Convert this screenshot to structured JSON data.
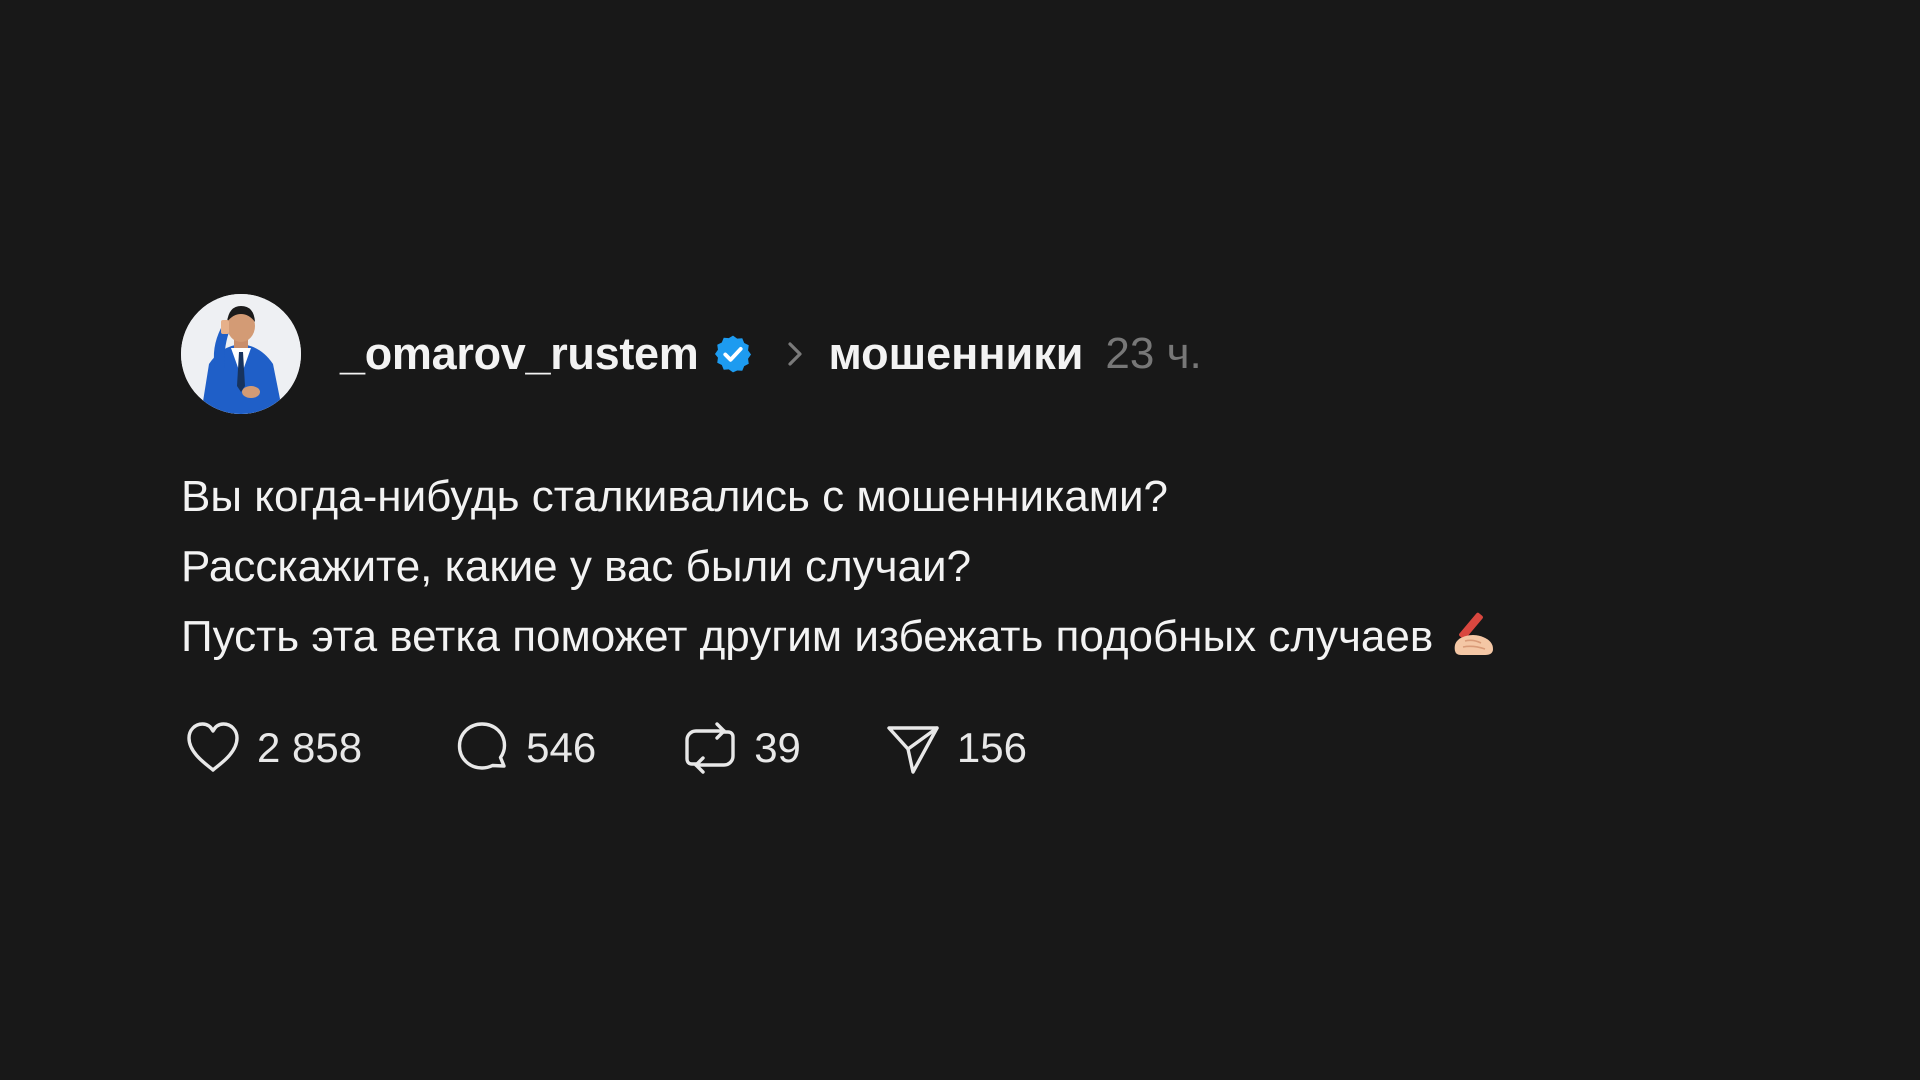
{
  "post": {
    "author": {
      "username": "_omarov_rustem",
      "verified_icon": "verified-badge-icon",
      "avatar_icon": "avatar-photo"
    },
    "topic": "мошенники",
    "time_ago": "23 ч.",
    "text_lines": [
      "Вы когда-нибудь сталкивались с мошенниками?",
      "Расскажите, какие у вас были случаи?",
      "Пусть эта ветка поможет другим избежать подобных случаев"
    ],
    "emoji": "writing-hand-emoji",
    "actions": {
      "likes": "2 858",
      "comments": "546",
      "reposts": "39",
      "shares": "156"
    }
  },
  "colors": {
    "background": "#181818",
    "text": "#f3f3f3",
    "muted": "#777777",
    "verified": "#1d9bf0"
  }
}
